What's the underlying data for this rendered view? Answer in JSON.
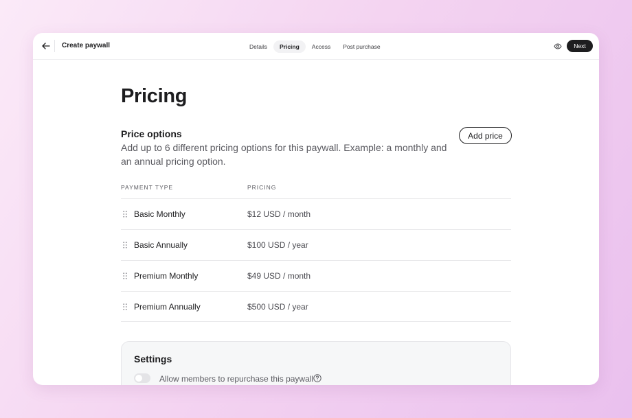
{
  "header": {
    "title": "Create paywall",
    "tabs": [
      {
        "label": "Details",
        "active": false
      },
      {
        "label": "Pricing",
        "active": true
      },
      {
        "label": "Access",
        "active": false
      },
      {
        "label": "Post purchase",
        "active": false
      }
    ],
    "preview_icon": "eye-icon",
    "back_icon": "arrow-left-icon",
    "next_label": "Next"
  },
  "main": {
    "title": "Pricing",
    "price_options": {
      "title": "Price options",
      "description": "Add up to 6 different pricing options for this paywall. Example: a monthly and an annual pricing option.",
      "add_button_label": "Add price"
    },
    "table": {
      "columns": [
        "PAYMENT TYPE",
        "PRICING"
      ],
      "rows": [
        {
          "type": "Basic Monthly",
          "price": "$12 USD / month"
        },
        {
          "type": "Basic Annually",
          "price": "$100 USD / year"
        },
        {
          "type": "Premium Monthly",
          "price": "$49 USD / month"
        },
        {
          "type": "Premium Annually",
          "price": "$500 USD / year"
        }
      ]
    },
    "settings": {
      "title": "Settings",
      "repurchase_label": "Allow members to repurchase this paywall",
      "repurchase_enabled": false
    }
  },
  "colors": {
    "accent": "#1d1d1f",
    "background_gradient_start": "#fbeaf8",
    "background_gradient_end": "#eac0ee"
  }
}
